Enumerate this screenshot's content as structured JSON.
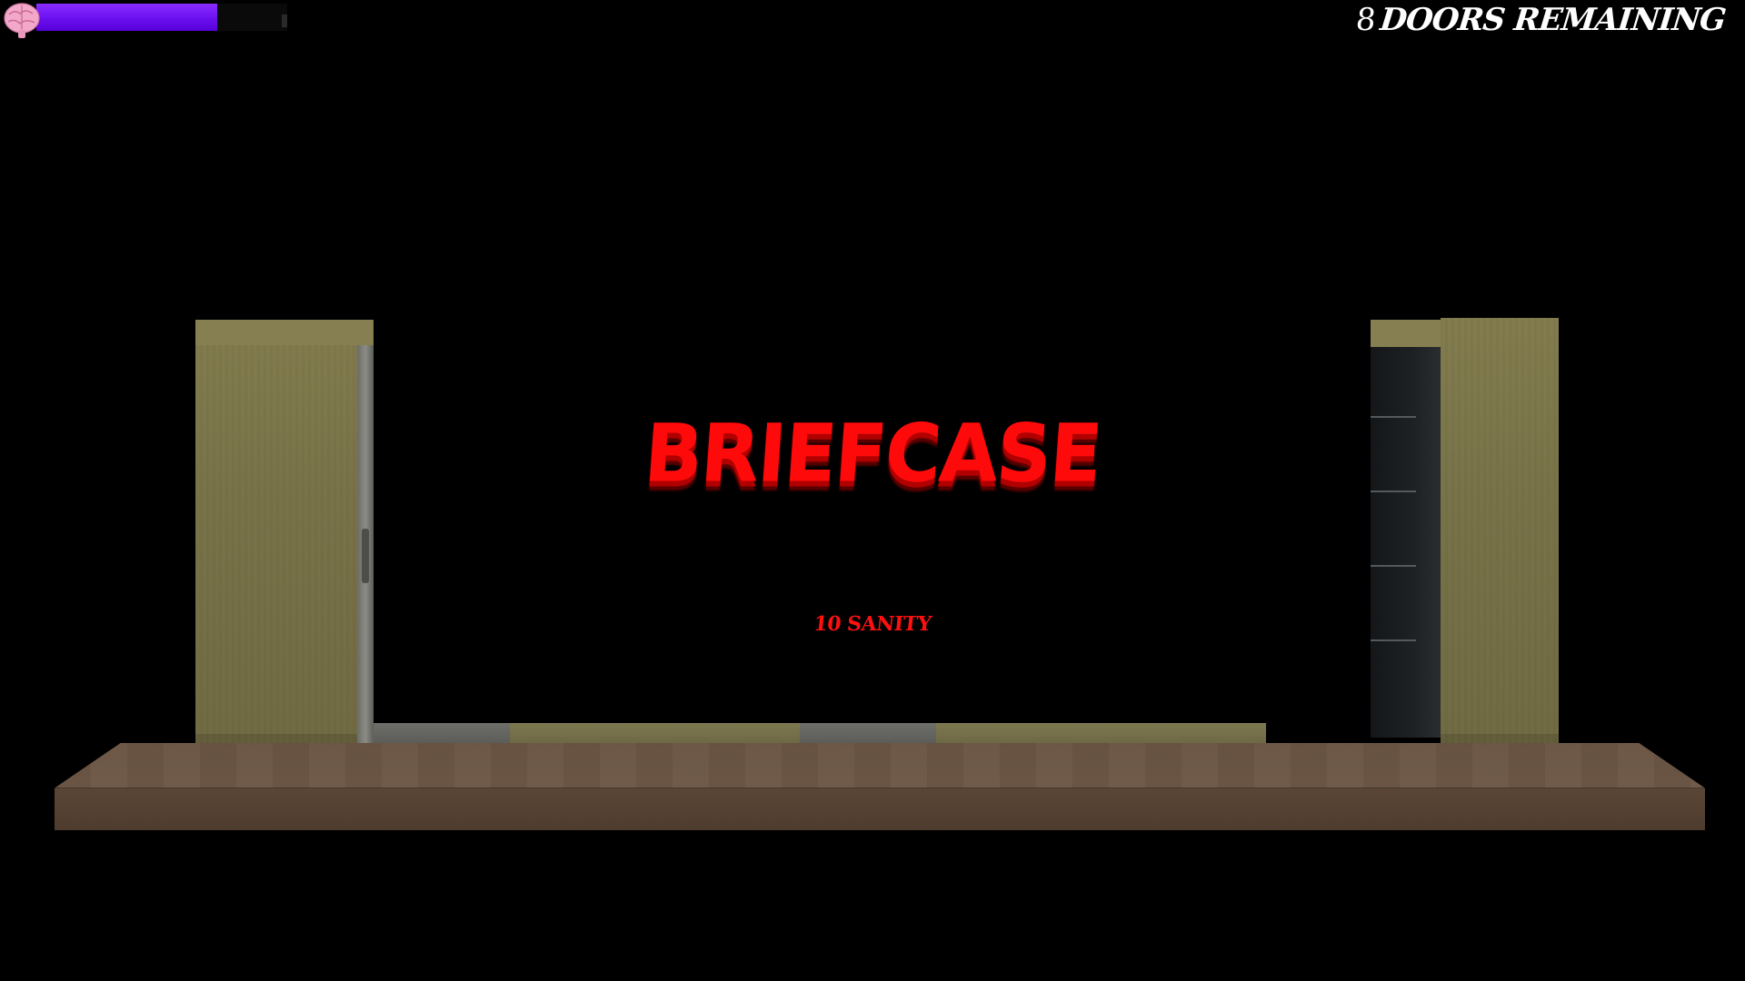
{
  "hud": {
    "sanity_icon": "brain-icon",
    "sanity_level": 0.72,
    "sanity_color": "#6a10f0",
    "doors_count": "8",
    "doors_label": "DOORS REMAINING"
  },
  "pickup": {
    "item_name": "BRIEFCASE",
    "sanity_amount": "10",
    "sanity_label": "SANITY",
    "text_color": "#ff0a0a"
  },
  "scene": {
    "wall_color": "#7a744a",
    "floor_color": "#6a5544",
    "right_door_color": "#1e2124"
  }
}
